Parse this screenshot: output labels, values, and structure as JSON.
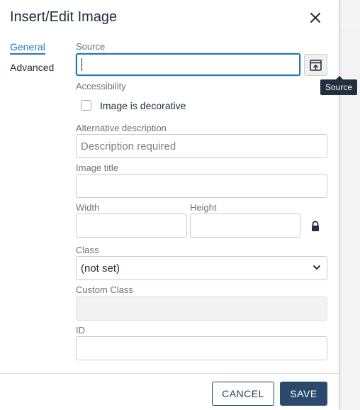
{
  "dialog": {
    "title": "Insert/Edit Image",
    "close_label": "×"
  },
  "tabs": [
    {
      "label": "General",
      "active": true
    },
    {
      "label": "Advanced",
      "active": false
    }
  ],
  "fields": {
    "source": {
      "label": "Source",
      "value": ""
    },
    "browse_tooltip": "Source",
    "accessibility_label": "Accessibility",
    "decorative_label": "Image is decorative",
    "alt": {
      "label": "Alternative description",
      "placeholder": "Description required"
    },
    "image_title": {
      "label": "Image title",
      "value": ""
    },
    "width": {
      "label": "Width",
      "value": ""
    },
    "height": {
      "label": "Height",
      "value": ""
    },
    "class": {
      "label": "Class",
      "selected": "(not set)"
    },
    "custom_class": {
      "label": "Custom Class",
      "value": ""
    },
    "id": {
      "label": "ID",
      "value": ""
    }
  },
  "footer": {
    "cancel_label": "CANCEL",
    "save_label": "SAVE"
  },
  "colors": {
    "accent": "#207ab7",
    "primary_button": "#2b4a6b",
    "tooltip_bg": "#222f3e"
  }
}
